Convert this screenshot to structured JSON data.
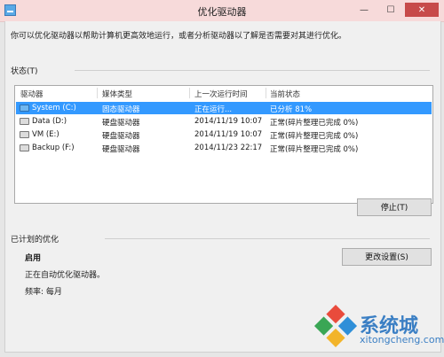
{
  "window": {
    "title": "优化驱动器",
    "minimize": "—",
    "maximize": "☐",
    "close": "✕"
  },
  "intro": "你可以优化驱动器以帮助计算机更高效地运行，或者分析驱动器以了解是否需要对其进行优化。",
  "status": {
    "label": "状态(T)",
    "columns": [
      "驱动器",
      "媒体类型",
      "上一次运行时间",
      "当前状态"
    ],
    "rows": [
      {
        "drive": "System (C:)",
        "media": "固态驱动器",
        "last_run": "正在运行...",
        "status": "已分析 81%",
        "selected": true,
        "icon": "system-drive-icon"
      },
      {
        "drive": "Data (D:)",
        "media": "硬盘驱动器",
        "last_run": "2014/11/19 10:07",
        "status": "正常(碎片整理已完成 0%)",
        "selected": false,
        "icon": "hard-drive-icon"
      },
      {
        "drive": "VM (E:)",
        "media": "硬盘驱动器",
        "last_run": "2014/11/19 10:07",
        "status": "正常(碎片整理已完成 0%)",
        "selected": false,
        "icon": "hard-drive-icon"
      },
      {
        "drive": "Backup (F:)",
        "media": "硬盘驱动器",
        "last_run": "2014/11/23 22:17",
        "status": "正常(碎片整理已完成 0%)",
        "selected": false,
        "icon": "hard-drive-icon"
      }
    ],
    "stop_button": "停止(T)"
  },
  "scheduled": {
    "label": "已计划的优化",
    "state": "启用",
    "description": "正在自动优化驱动器。",
    "frequency": "频率: 每月",
    "change_button": "更改设置(S)"
  },
  "watermark": {
    "text": "系统城",
    "url": "xitongcheng.com"
  }
}
